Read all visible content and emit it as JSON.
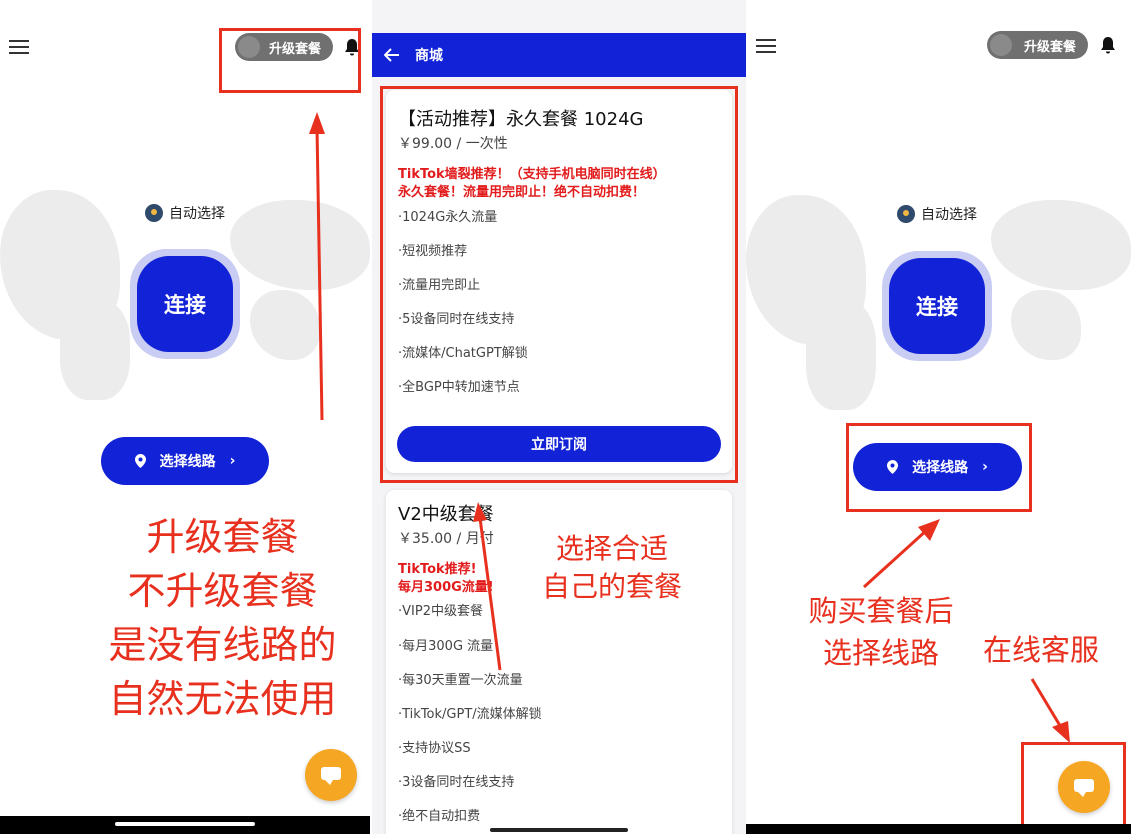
{
  "left": {
    "upgrade_label": "升级套餐",
    "auto_select": "自动选择",
    "connect": "连接",
    "route": "选择线路",
    "annotation_lines": [
      "升级套餐",
      "不升级套餐",
      "是没有线路的",
      "自然无法使用"
    ]
  },
  "shop": {
    "title": "商城",
    "plan1": {
      "name": "【活动推荐】永久套餐 1024G",
      "price": "￥99.00 / 一次性",
      "highlight1": "TikTok墙裂推荐！（支持手机电脑同时在线）",
      "highlight2": "永久套餐！流量用完即止！绝不自动扣费！",
      "features": [
        "·1024G永久流量",
        "·短视频推荐",
        "·流量用完即止",
        "·5设备同时在线支持",
        "·流媒体/ChatGPT解锁",
        "·全BGP中转加速节点"
      ],
      "subscribe": "立即订阅"
    },
    "plan2": {
      "name": "V2中级套餐",
      "price": "￥35.00 / 月付",
      "highlight1": "TikTok推荐!",
      "highlight2": "每月300G流量!",
      "features": [
        "·VIP2中级套餐",
        "·每月300G 流量",
        "·每30天重置一次流量",
        "·TikTok/GPT/流媒体解锁",
        "·支持协议SS",
        "·3设备同时在线支持",
        "·绝不自动扣费"
      ]
    },
    "annotation_lines": [
      "选择合适",
      "自己的套餐"
    ]
  },
  "right": {
    "upgrade_label": "升级套餐",
    "auto_select": "自动选择",
    "connect": "连接",
    "route": "选择线路",
    "annotation_buy": [
      "购买套餐后",
      "选择线路"
    ],
    "annotation_support": "在线客服"
  },
  "colors": {
    "brand": "#1222d6",
    "annotation": "#e8301f",
    "chat": "#f5a623"
  }
}
